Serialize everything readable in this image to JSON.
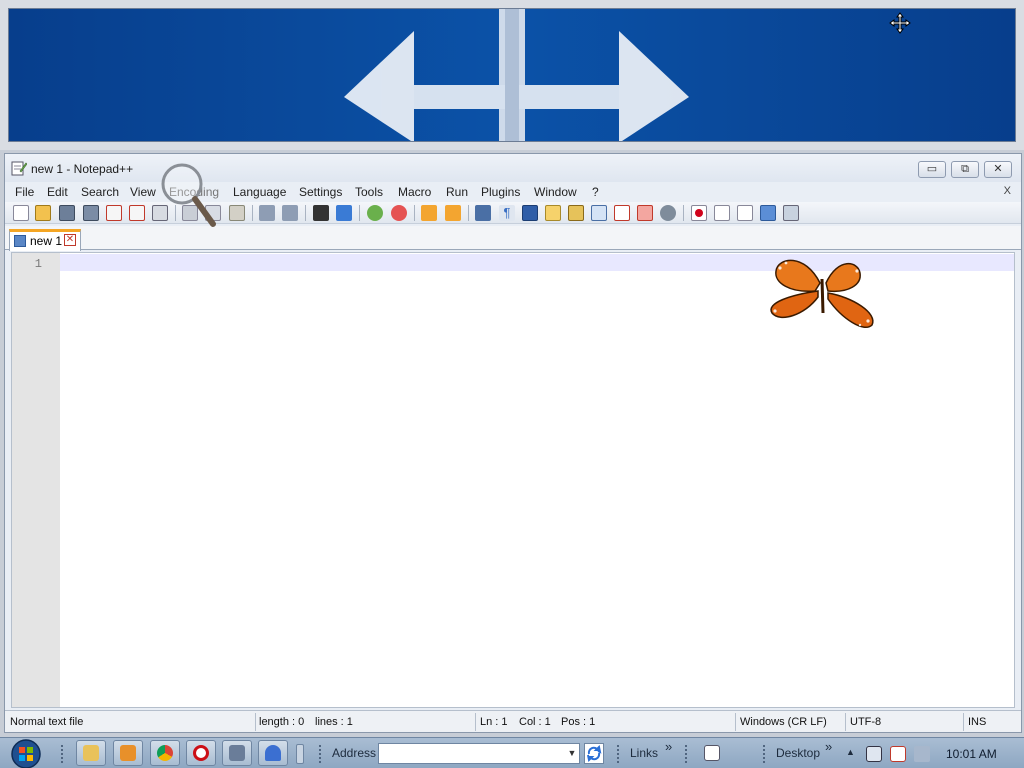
{
  "notepad": {
    "title": "new 1 - Notepad++",
    "window_controls": {
      "minimize": "▭",
      "maximize": "⧉",
      "close": "✕"
    },
    "menu": [
      "File",
      "Edit",
      "Search",
      "View",
      "Encoding",
      "Language",
      "Settings",
      "Tools",
      "Macro",
      "Run",
      "Plugins",
      "Window",
      "?"
    ],
    "menu_close": "X",
    "tab": {
      "label": "new 1",
      "close": "✕"
    },
    "editor": {
      "line_number": "1",
      "content": ""
    },
    "status": {
      "file_type": "Normal text file",
      "length": "length : 0",
      "lines": "lines : 1",
      "ln": "Ln : 1",
      "col": "Col : 1",
      "pos": "Pos : 1",
      "eol": "Windows (CR LF)",
      "encoding": "UTF-8",
      "mode": "INS"
    }
  },
  "taskbar": {
    "address_label": "Address",
    "address_value": "",
    "links_label": "Links",
    "desktop_label": "Desktop",
    "chevron": "»",
    "clock": "10:01 AM"
  },
  "colors": {
    "banner_blue": "#0b4fa3",
    "tab_accent": "#f5a623",
    "current_line": "#e8e8ff"
  }
}
